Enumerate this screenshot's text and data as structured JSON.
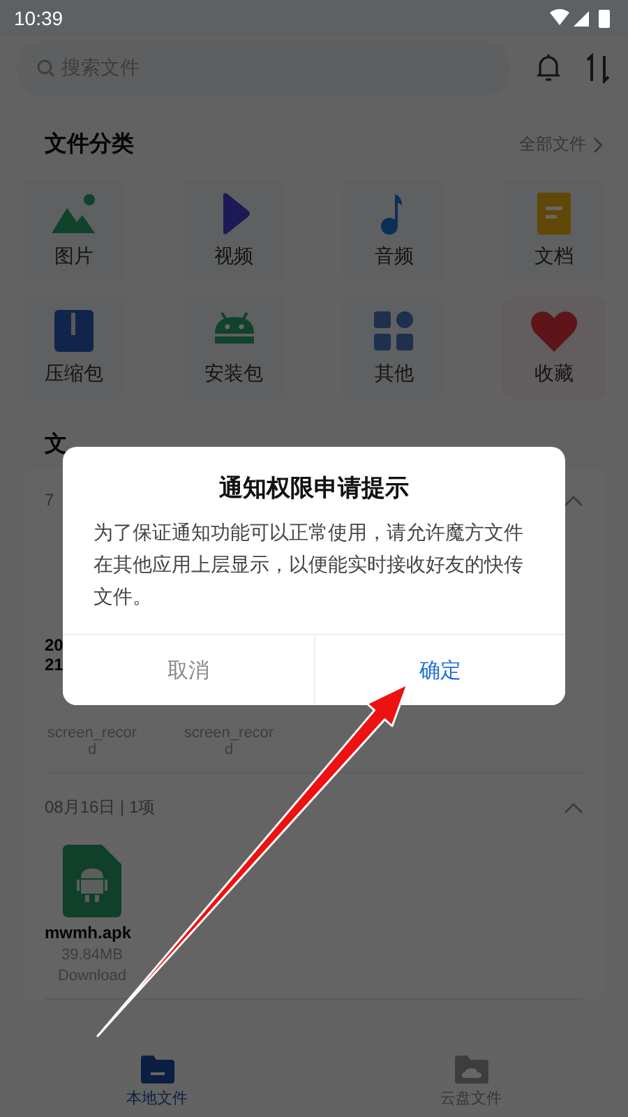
{
  "status_bar": {
    "time": "10:39"
  },
  "search": {
    "placeholder": "搜索文件"
  },
  "categories": {
    "title": "文件分类",
    "all_link": "全部文件",
    "items": [
      {
        "label": "图片",
        "kind": "image"
      },
      {
        "label": "视频",
        "kind": "video"
      },
      {
        "label": "音频",
        "kind": "audio"
      },
      {
        "label": "文档",
        "kind": "doc"
      },
      {
        "label": "压缩包",
        "kind": "zip"
      },
      {
        "label": "安装包",
        "kind": "apk"
      },
      {
        "label": "其他",
        "kind": "other"
      },
      {
        "label": "收藏",
        "kind": "favorite"
      }
    ]
  },
  "timeline": {
    "title": "文",
    "groups": [
      {
        "label": "7",
        "expanded": true,
        "files": [
          {
            "name_lines": [
              "20",
              "21"
            ],
            "path": "screen_record"
          },
          {
            "path": "screen_record"
          }
        ]
      },
      {
        "label": "08月16日 | 1项",
        "expanded": true,
        "files": [
          {
            "kind": "apk",
            "name_lines": [
              "mwmh.apk"
            ],
            "size": "39.84MB",
            "path": "Download"
          }
        ]
      }
    ]
  },
  "bottom_nav": [
    {
      "label": "本地文件",
      "kind": "local",
      "selected": true
    },
    {
      "label": "云盘文件",
      "kind": "cloud",
      "selected": false
    }
  ],
  "dialog": {
    "title": "通知权限申请提示",
    "message": "为了保证通知功能可以正常使用，请允许魔方文件在其他应用上层显示，以便能实时接收好友的快传文件。",
    "buttons": [
      {
        "label": "取消",
        "kind": "cancel"
      },
      {
        "label": "确定",
        "kind": "confirm"
      }
    ]
  }
}
